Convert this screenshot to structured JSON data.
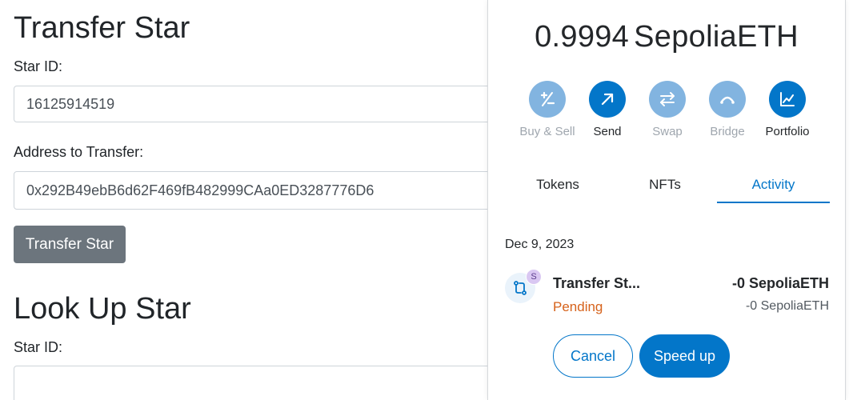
{
  "dapp": {
    "transfer_section": {
      "title": "Transfer Star",
      "star_id_label": "Star ID:",
      "star_id_value": "16125914519",
      "address_label": "Address to Transfer:",
      "address_value": "0x292B49ebB6d62F469fB482999CAa0ED3287776D6",
      "button_label": "Transfer Star"
    },
    "lookup_section": {
      "title": "Look Up Star",
      "star_id_label": "Star ID:",
      "star_id_value": ""
    }
  },
  "wallet": {
    "balance_amount": "0.9994",
    "balance_unit": "SepoliaETH",
    "actions": [
      {
        "label": "Buy & Sell",
        "icon": "buy-sell-icon",
        "enabled": false
      },
      {
        "label": "Send",
        "icon": "send-arrow-icon",
        "enabled": true
      },
      {
        "label": "Swap",
        "icon": "swap-icon",
        "enabled": false
      },
      {
        "label": "Bridge",
        "icon": "bridge-icon",
        "enabled": false
      },
      {
        "label": "Portfolio",
        "icon": "portfolio-chart-icon",
        "enabled": true
      }
    ],
    "tabs": [
      {
        "label": "Tokens",
        "active": false
      },
      {
        "label": "NFTs",
        "active": false
      },
      {
        "label": "Activity",
        "active": true
      }
    ],
    "activity": {
      "date": "Dec 9, 2023",
      "transaction": {
        "icon": "contract-interaction-icon",
        "badge": "S",
        "title": "Transfer St...",
        "status": "Pending",
        "amount": "-0 SepoliaETH",
        "amount_secondary": "-0 SepoliaETH",
        "cancel_label": "Cancel",
        "speed_up_label": "Speed up"
      }
    },
    "colors": {
      "primary": "#0376c9",
      "primary_disabled": "#82b4e0",
      "pending": "#d6621b",
      "grey_button": "#6c757d"
    }
  }
}
